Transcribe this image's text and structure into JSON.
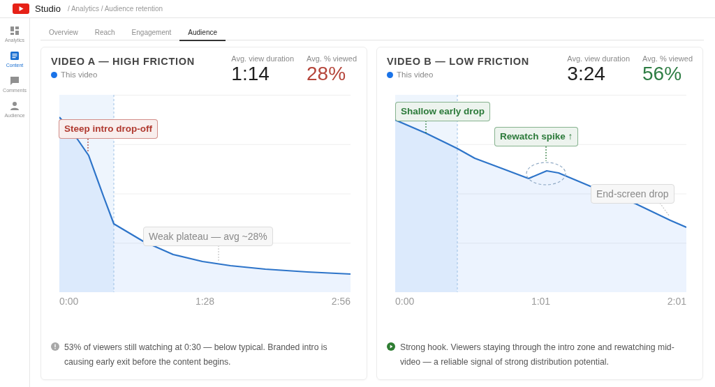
{
  "header": {
    "app_name": "Studio",
    "breadcrumb": "/ Analytics / Audience retention"
  },
  "sidebar": {
    "items": [
      {
        "label": "Analytics",
        "selected": false
      },
      {
        "label": "Content",
        "selected": true
      },
      {
        "label": "Comments",
        "selected": false
      },
      {
        "label": "Audience",
        "selected": false
      }
    ]
  },
  "tabs": [
    {
      "label": "Overview",
      "selected": false
    },
    {
      "label": "Reach",
      "selected": false
    },
    {
      "label": "Engagement",
      "selected": false
    },
    {
      "label": "Audience",
      "selected": true
    }
  ],
  "cards": [
    {
      "title": "VIDEO A — HIGH FRICTION",
      "legend": "This video",
      "stats": [
        {
          "label": "Avg. view duration",
          "value": "1:14",
          "color": "#1f1f1f"
        },
        {
          "label": "Avg. % viewed",
          "value": "28%",
          "color": "#b5453a"
        }
      ],
      "x_labels": [
        "0:00",
        "1:28",
        "2:56"
      ],
      "callouts": [
        {
          "text": "Steep intro drop-off",
          "kind": "highlight",
          "color": "#b03a30"
        },
        {
          "text": "Weak plateau — avg ~28%",
          "kind": "note",
          "color": "#8a8a8a"
        }
      ],
      "insight": {
        "kind": "info",
        "text": "53% of viewers still watching at 0:30 — below typical. Branded intro is causing early exit before the content begins."
      }
    },
    {
      "title": "VIDEO B — LOW FRICTION",
      "legend": "This video",
      "stats": [
        {
          "label": "Avg. view duration",
          "value": "3:24",
          "color": "#1f1f1f"
        },
        {
          "label": "Avg. % viewed",
          "value": "56%",
          "color": "#2e7d44"
        }
      ],
      "x_labels": [
        "0:00",
        "1:01",
        "2:01"
      ],
      "callouts": [
        {
          "text": "Shallow early drop",
          "kind": "highlight",
          "color": "#2c7a3a"
        },
        {
          "text": "Rewatch spike ↑",
          "kind": "highlight",
          "color": "#2c7a3a"
        },
        {
          "text": "End-screen drop",
          "kind": "note",
          "color": "#8a8a8a"
        }
      ],
      "insight": {
        "kind": "positive",
        "text": "Strong hook. Viewers staying through the intro zone and rewatching mid-video — a reliable signal of strong distribution potential."
      }
    }
  ]
}
